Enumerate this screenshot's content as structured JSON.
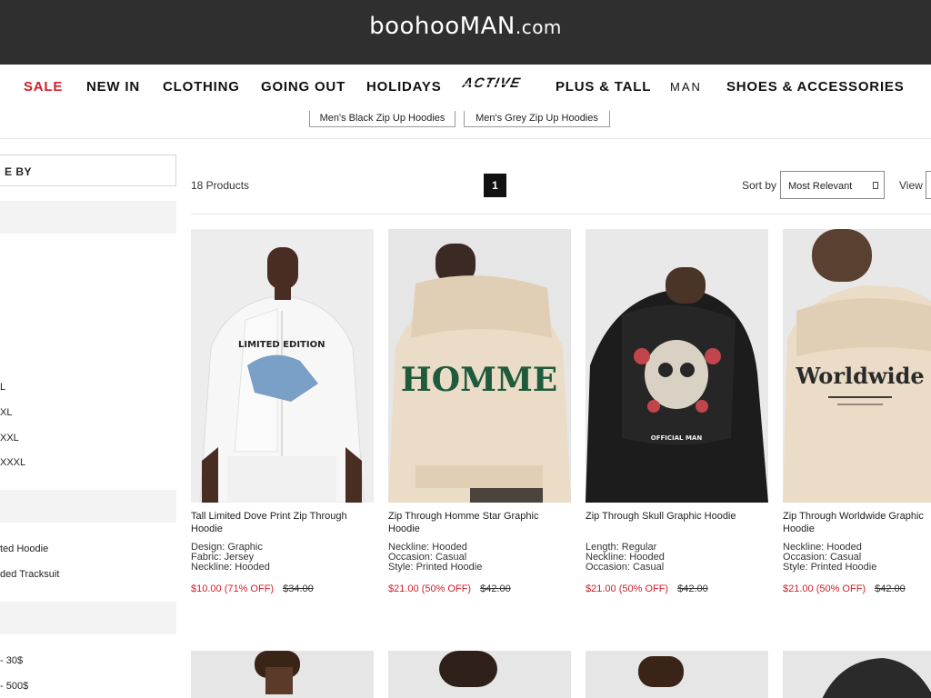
{
  "header": {
    "logo_main": "boohooMAN",
    "logo_suffix": ".com"
  },
  "nav": {
    "items": [
      {
        "label": "SALE"
      },
      {
        "label": "NEW IN"
      },
      {
        "label": "CLOTHING"
      },
      {
        "label": "GOING OUT"
      },
      {
        "label": "HOLIDAYS"
      },
      {
        "label": "ACTIVE"
      },
      {
        "label": "PLUS & TALL"
      },
      {
        "label": "MAN"
      },
      {
        "label": "SHOES & ACCESSORIES"
      }
    ]
  },
  "chips": [
    {
      "label": "Men's Black Zip Up Hoodies"
    },
    {
      "label": "Men's Grey Zip Up Hoodies"
    }
  ],
  "sidebar": {
    "sort_by_label": "E BY",
    "size_options": [
      "L",
      "XL",
      "XXL",
      "XXXL"
    ],
    "style_options": [
      "ted Hoodie",
      "ded Tracksuit"
    ],
    "price_options": [
      "- 30$",
      "- 500$"
    ]
  },
  "toolbar": {
    "product_count": "18 Products",
    "current_page": "1",
    "sort_label": "Sort by",
    "sort_value": "Most Relevant",
    "view_label": "View"
  },
  "products": [
    {
      "title_line1": "Tall Limited Dove Print Zip Through",
      "title_line2": "Hoodie",
      "attrs": [
        "Design: Graphic",
        "Fabric: Jersey",
        "Neckline: Hooded"
      ],
      "price_now": "$10.00 (71% OFF)",
      "price_was": "$34.00",
      "graphic_text": "LIMITED EDITION"
    },
    {
      "title_line1": "Zip Through Homme Star Graphic",
      "title_line2": "Hoodie",
      "attrs": [
        "Neckline: Hooded",
        "Occasion: Casual",
        "Style: Printed Hoodie"
      ],
      "price_now": "$21.00 (50% OFF)",
      "price_was": "$42.00",
      "graphic_text": "HOMME"
    },
    {
      "title_line1": "Zip Through Skull Graphic Hoodie",
      "title_line2": "",
      "attrs": [
        "Length: Regular",
        "Neckline: Hooded",
        "Occasion: Casual"
      ],
      "price_now": "$21.00 (50% OFF)",
      "price_was": "$42.00",
      "graphic_text": "OFFICIAL MAN"
    },
    {
      "title_line1": "Zip Through Worldwide Graphic",
      "title_line2": "Hoodie",
      "attrs": [
        "Neckline: Hooded",
        "Occasion: Casual",
        "Style: Printed Hoodie"
      ],
      "price_now": "$21.00 (50% OFF)",
      "price_was": "$42.00",
      "graphic_text": "Worldwide"
    }
  ]
}
